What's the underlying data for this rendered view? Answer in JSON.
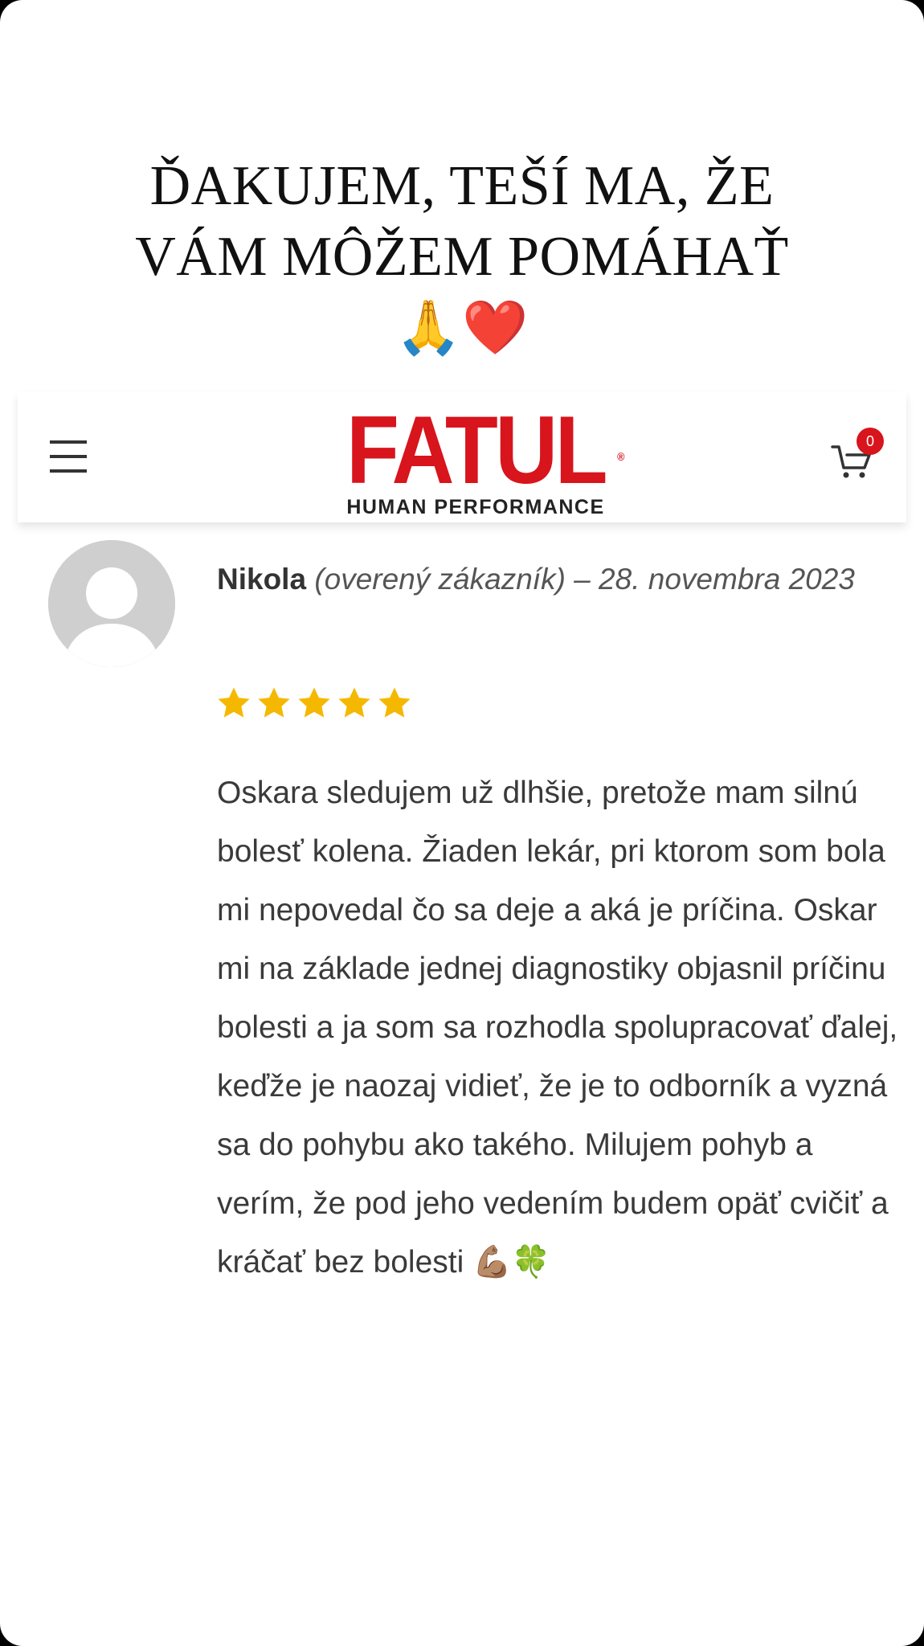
{
  "overlay": {
    "line1": "ĎAKUJEM, TEŠÍ MA, ŽE",
    "line2": "VÁM MÔŽEM POMÁHAŤ",
    "emoji": "🙏❤️"
  },
  "header": {
    "logo_word": "FATUL",
    "logo_reg": "®",
    "logo_tagline": "HUMAN PERFORMANCE",
    "cart_count": "0"
  },
  "review": {
    "author": "Nikola",
    "verified": "(overený zákazník)",
    "separator": " – ",
    "date": "28. novembra 2023",
    "rating": 5,
    "text": "Oskara sledujem už dlhšie, pretože mam silnú bolesť kolena. Žiaden lekár, pri ktorom som bola mi nepovedal čo sa deje a aká je príčina. Oskar mi na základe jednej diagnostiky objasnil príčinu bolesti a ja som sa rozhodla spolupracovať ďalej, keďže je naozaj vidieť, že je to odborník a vyzná sa do pohybu ako takého. Milujem pohyb a verím, že pod jeho vedením budem opäť cvičiť a kráčať bez bolesti 💪🏽🍀"
  },
  "colors": {
    "brand_red": "#d8141c",
    "star": "#f5b800",
    "avatar_gray": "#cfcfcf"
  },
  "icons": [
    "menu-icon",
    "cart-icon",
    "avatar-placeholder-icon",
    "star-icon"
  ]
}
